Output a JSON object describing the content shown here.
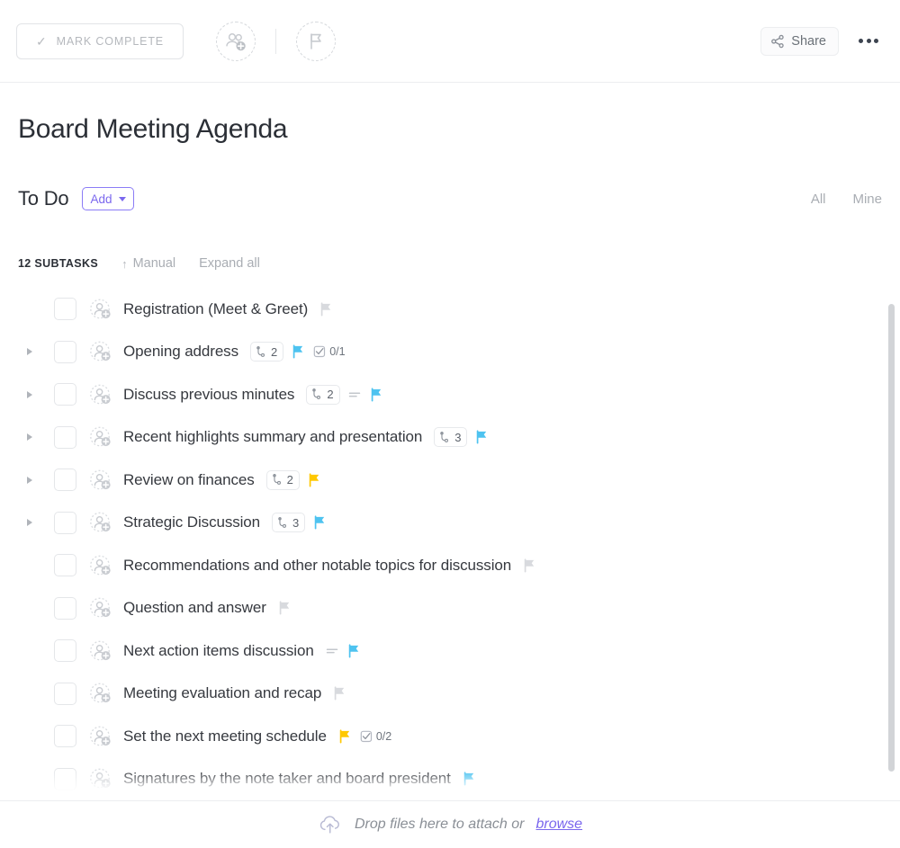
{
  "toolbar": {
    "mark_complete_label": "MARK COMPLETE",
    "check_glyph": "✓",
    "assignee_icon_name": "add-assignee-icon",
    "flag_icon_name": "set-priority-flag-icon",
    "share_label": "Share",
    "more_label": "•••"
  },
  "task": {
    "title": "Board Meeting Agenda",
    "status": "To Do",
    "add_label": "Add"
  },
  "filters": {
    "all": "All",
    "mine": "Mine"
  },
  "meta": {
    "subtask_count": "12 SUBTASKS",
    "sort_arrow": "↑",
    "sort_label": "Manual",
    "expand_label": "Expand all"
  },
  "colors": {
    "flag_blue": "#4ec3f0",
    "flag_yellow": "#ffc800",
    "flag_gray": "#d8dade",
    "accent_purple": "#7b68ee",
    "text_dark": "#36393f",
    "text_muted": "#a9adb3"
  },
  "subtasks": [
    {
      "name": "Registration (Meet & Greet)",
      "expandable": false,
      "checked": false,
      "subtask_badge": null,
      "has_description": false,
      "flag": "gray",
      "checklist": null
    },
    {
      "name": "Opening address",
      "expandable": true,
      "checked": false,
      "subtask_badge": "2",
      "has_description": false,
      "flag": "blue",
      "checklist": "0/1"
    },
    {
      "name": "Discuss previous minutes",
      "expandable": true,
      "checked": false,
      "subtask_badge": "2",
      "has_description": true,
      "flag": "blue",
      "checklist": null
    },
    {
      "name": "Recent highlights summary and presentation",
      "expandable": true,
      "checked": false,
      "subtask_badge": "3",
      "has_description": false,
      "flag": "blue",
      "checklist": null
    },
    {
      "name": "Review on finances",
      "expandable": true,
      "checked": false,
      "subtask_badge": "2",
      "has_description": false,
      "flag": "yellow",
      "checklist": null
    },
    {
      "name": "Strategic Discussion",
      "expandable": true,
      "checked": false,
      "subtask_badge": "3",
      "has_description": false,
      "flag": "blue",
      "checklist": null
    },
    {
      "name": "Recommendations and other notable topics for discussion",
      "expandable": false,
      "checked": false,
      "subtask_badge": null,
      "has_description": false,
      "flag": "gray",
      "checklist": null
    },
    {
      "name": "Question and answer",
      "expandable": false,
      "checked": false,
      "subtask_badge": null,
      "has_description": false,
      "flag": "gray",
      "checklist": null
    },
    {
      "name": "Next action items discussion",
      "expandable": false,
      "checked": false,
      "subtask_badge": null,
      "has_description": true,
      "flag": "blue",
      "checklist": null
    },
    {
      "name": "Meeting evaluation and recap",
      "expandable": false,
      "checked": false,
      "subtask_badge": null,
      "has_description": false,
      "flag": "gray",
      "checklist": null
    },
    {
      "name": "Set the next meeting schedule",
      "expandable": false,
      "checked": false,
      "subtask_badge": null,
      "has_description": false,
      "flag": "yellow",
      "checklist": "0/2"
    },
    {
      "name": "Signatures by the note taker and board president",
      "expandable": false,
      "checked": false,
      "subtask_badge": null,
      "has_description": false,
      "flag": "blue",
      "checklist": null
    }
  ],
  "attach": {
    "text": "Drop files here to attach or",
    "browse_label": "browse"
  }
}
